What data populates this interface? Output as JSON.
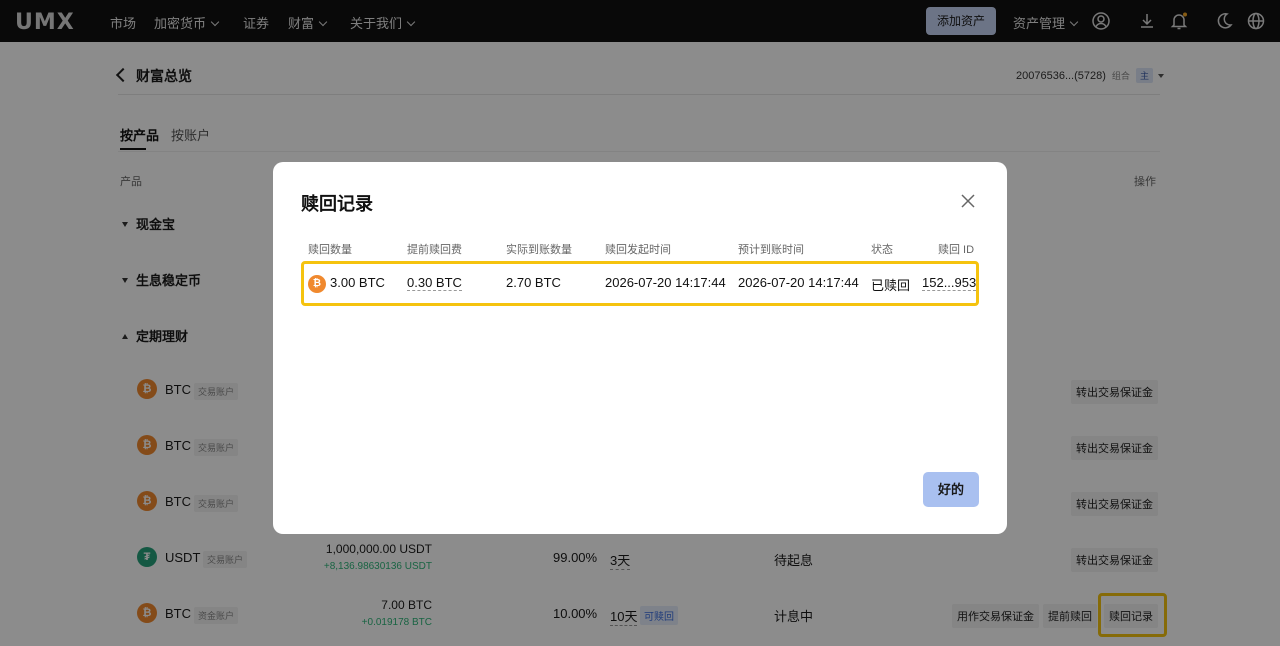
{
  "nav": {
    "logo": "UMX",
    "items": [
      "市场",
      "加密货币",
      "证券",
      "财富",
      "关于我们"
    ],
    "add_asset": "添加资产",
    "asset_mgmt": "资产管理"
  },
  "page": {
    "back_title": "财富总览",
    "account_id": "20076536...(5728)",
    "account_combo": "组合",
    "account_main": "主",
    "tabs": [
      "按产品",
      "按账户"
    ],
    "col_product": "产品",
    "col_action": "操作",
    "sections": [
      "现金宝",
      "生息稳定币",
      "定期理财"
    ]
  },
  "rows": [
    {
      "asset": "BTC",
      "account": "交易账户",
      "action": "转出交易保证金"
    },
    {
      "asset": "BTC",
      "account": "交易账户",
      "action": "转出交易保证金"
    },
    {
      "asset": "BTC",
      "account": "交易账户",
      "action": "转出交易保证金"
    },
    {
      "asset": "USDT",
      "account": "交易账户",
      "amount": "1,000,000.00 USDT",
      "earned": "+8,136.98630136 USDT",
      "apr": "99.00%",
      "term": "3天",
      "status": "待起息",
      "action": "转出交易保证金"
    },
    {
      "asset": "BTC",
      "account": "资金账户",
      "amount": "7.00 BTC",
      "earned": "+0.019178 BTC",
      "apr": "10.00%",
      "term": "10天",
      "redeemable": "可赎回",
      "status": "计息中",
      "action1": "用作交易保证金",
      "action2": "提前赎回",
      "action3": "赎回记录"
    }
  ],
  "modal": {
    "title": "赎回记录",
    "headers": [
      "赎回数量",
      "提前赎回费",
      "实际到账数量",
      "赎回发起时间",
      "预计到账时间",
      "状态",
      "赎回 ID"
    ],
    "record": {
      "amount": "3.00 BTC",
      "fee": "0.30 BTC",
      "received": "2.70 BTC",
      "start_time": "2026-07-20 14:17:44",
      "expected_time": "2026-07-20 14:17:44",
      "status": "已赎回",
      "id": "152...953"
    },
    "ok": "好的"
  },
  "colors": {
    "highlight": "#f5c30f",
    "btc": "#f0892e",
    "usdt": "#26a17b",
    "earned": "#2fb67a",
    "primary_button": "#a9c0f0"
  }
}
